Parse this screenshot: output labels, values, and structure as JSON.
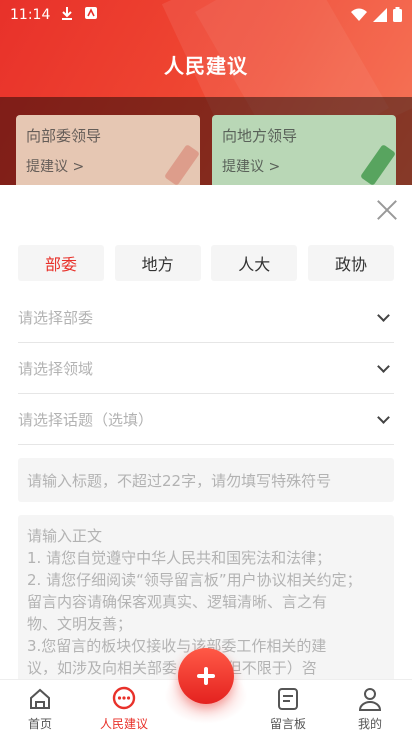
{
  "status_bar": {
    "time": "11:14"
  },
  "header": {
    "title": "人民建议",
    "cards": [
      {
        "title": "向部委领导",
        "subtitle": "提建议 >"
      },
      {
        "title": "向地方领导",
        "subtitle": "提建议 >"
      }
    ]
  },
  "sheet": {
    "tabs": [
      "部委",
      "地方",
      "人大",
      "政协"
    ],
    "active_tab": "部委",
    "selects": [
      {
        "placeholder": "请选择部委"
      },
      {
        "placeholder": "请选择领域"
      },
      {
        "placeholder": "请选择话题（选填）"
      }
    ],
    "title_input_placeholder": "请输入标题，不超过22字，请勿填写特殊符号",
    "body_lines": [
      "请输入正文",
      "1. 请您自觉遵守中华人民共和国宪法和法律；",
      "2. 请您仔细阅读“领导留言板”用户协议相关约定；",
      "留言内容请确保客观真实、逻辑清晰、言之有",
      "物、文明友善；",
      "3.您留言的板块仅接收与该部委工作相关的建",
      "议，如涉及向相关部委        包括（但不限于）咨"
    ]
  },
  "nav": {
    "items": [
      {
        "label": "首页",
        "icon": "home-icon"
      },
      {
        "label": "人民建议",
        "icon": "chat-bubble-icon"
      },
      {
        "label": "留言板",
        "icon": "message-board-icon"
      },
      {
        "label": "我的",
        "icon": "profile-icon"
      }
    ],
    "active": "人民建议",
    "fab_icon": "plus-icon"
  },
  "colors": {
    "accent": "#e8312a",
    "placeholder": "#b3b3b3"
  }
}
